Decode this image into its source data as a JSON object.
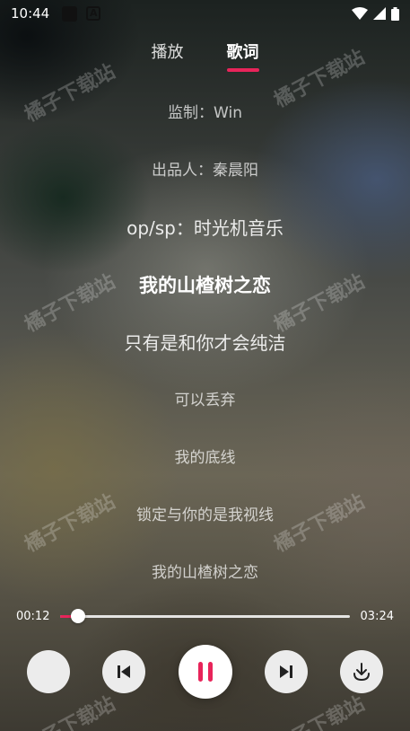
{
  "status_bar": {
    "time": "10:44",
    "notification_letter": "A"
  },
  "tabs": [
    {
      "label": "播放",
      "active": false
    },
    {
      "label": "歌词",
      "active": true
    }
  ],
  "lyrics": [
    "监制：Win",
    "出品人：秦晨阳",
    "op/sp：时光机音乐",
    "我的山楂树之恋",
    "只有是和你才会纯洁",
    "可以丢弃",
    "我的底线",
    "锁定与你的是我视线",
    "我的山楂树之恋"
  ],
  "current_lyric_index": 3,
  "player": {
    "elapsed": "00:12",
    "duration": "03:24",
    "progress": 0.062,
    "state": "playing"
  },
  "watermark": "橘子下载站",
  "colors": {
    "accent": "#e8245a",
    "button_bg": "#ececec"
  },
  "icons": [
    "signal-icon",
    "wifi-icon",
    "battery-icon",
    "previous-icon",
    "pause-icon",
    "next-icon",
    "download-icon"
  ]
}
